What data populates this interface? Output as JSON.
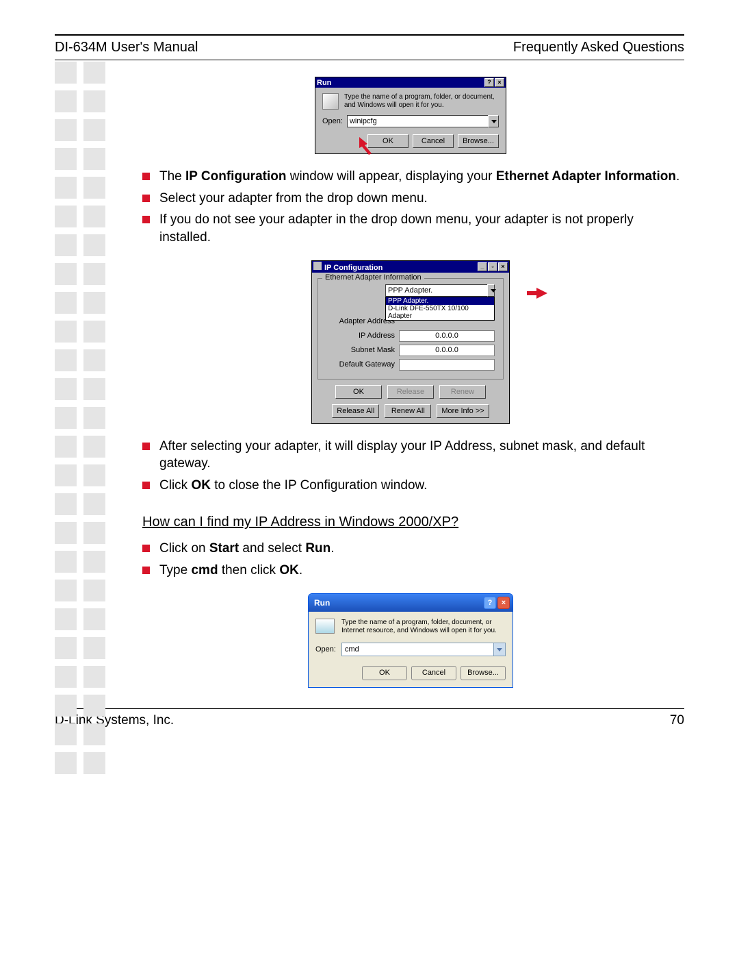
{
  "header": {
    "left": "DI-634M User's Manual",
    "right": "Frequently Asked Questions"
  },
  "run9x": {
    "title": "Run",
    "help_btn": "?",
    "close_btn": "×",
    "message": "Type the name of a program, folder, or document, and Windows will open it for you.",
    "open_label": "Open:",
    "open_value": "winipcfg",
    "ok": "OK",
    "cancel": "Cancel",
    "browse": "Browse..."
  },
  "bullets1": {
    "b1_pre": "The ",
    "b1_bold1": "IP Configuration",
    "b1_mid": " window will appear, displaying your ",
    "b1_bold2": "Ethernet Adapter Information",
    "b1_post": ".",
    "b2": "Select your adapter from the drop down menu.",
    "b3": "If you do not see your adapter in the drop down menu, your adapter is not properly installed."
  },
  "ipcfg": {
    "title": "IP Configuration",
    "min": "_",
    "restore": "▫",
    "close": "×",
    "group_label": "Ethernet Adapter Information",
    "dd_selected": "PPP Adapter.",
    "dd_opt1": "PPP Adapter.",
    "dd_opt2": "D-Link DFE-550TX 10/100 Adapter",
    "lbl_adapter": "Adapter Address",
    "lbl_ip": "IP Address",
    "lbl_subnet": "Subnet Mask",
    "lbl_gateway": "Default Gateway",
    "val_ip": "0.0.0.0",
    "val_subnet": "0.0.0.0",
    "val_gateway": "",
    "ok": "OK",
    "release": "Release",
    "renew": "Renew",
    "release_all": "Release All",
    "renew_all": "Renew All",
    "more_info": "More Info >>"
  },
  "bullets2": {
    "b1": "After selecting your adapter, it will display your IP Address, subnet mask, and default gateway.",
    "b2_pre": "Click ",
    "b2_bold": "OK",
    "b2_post": " to close the IP Configuration window."
  },
  "section2_q": "How can I find my IP Address in Windows 2000/XP?",
  "bullets3": {
    "b1_pre": "Click on ",
    "b1_bold1": "Start",
    "b1_mid": " and select ",
    "b1_bold2": "Run",
    "b1_post": ".",
    "b2_pre": "Type ",
    "b2_bold1": "cmd",
    "b2_mid": " then click ",
    "b2_bold2": "OK",
    "b2_post": "."
  },
  "runxp": {
    "title": "Run",
    "help_btn": "?",
    "close_btn": "×",
    "message": "Type the name of a program, folder, document, or Internet resource, and Windows will open it for you.",
    "open_label": "Open:",
    "open_value": "cmd",
    "ok": "OK",
    "cancel": "Cancel",
    "browse": "Browse..."
  },
  "footer": {
    "left": "D-Link Systems, Inc.",
    "right": "70"
  }
}
